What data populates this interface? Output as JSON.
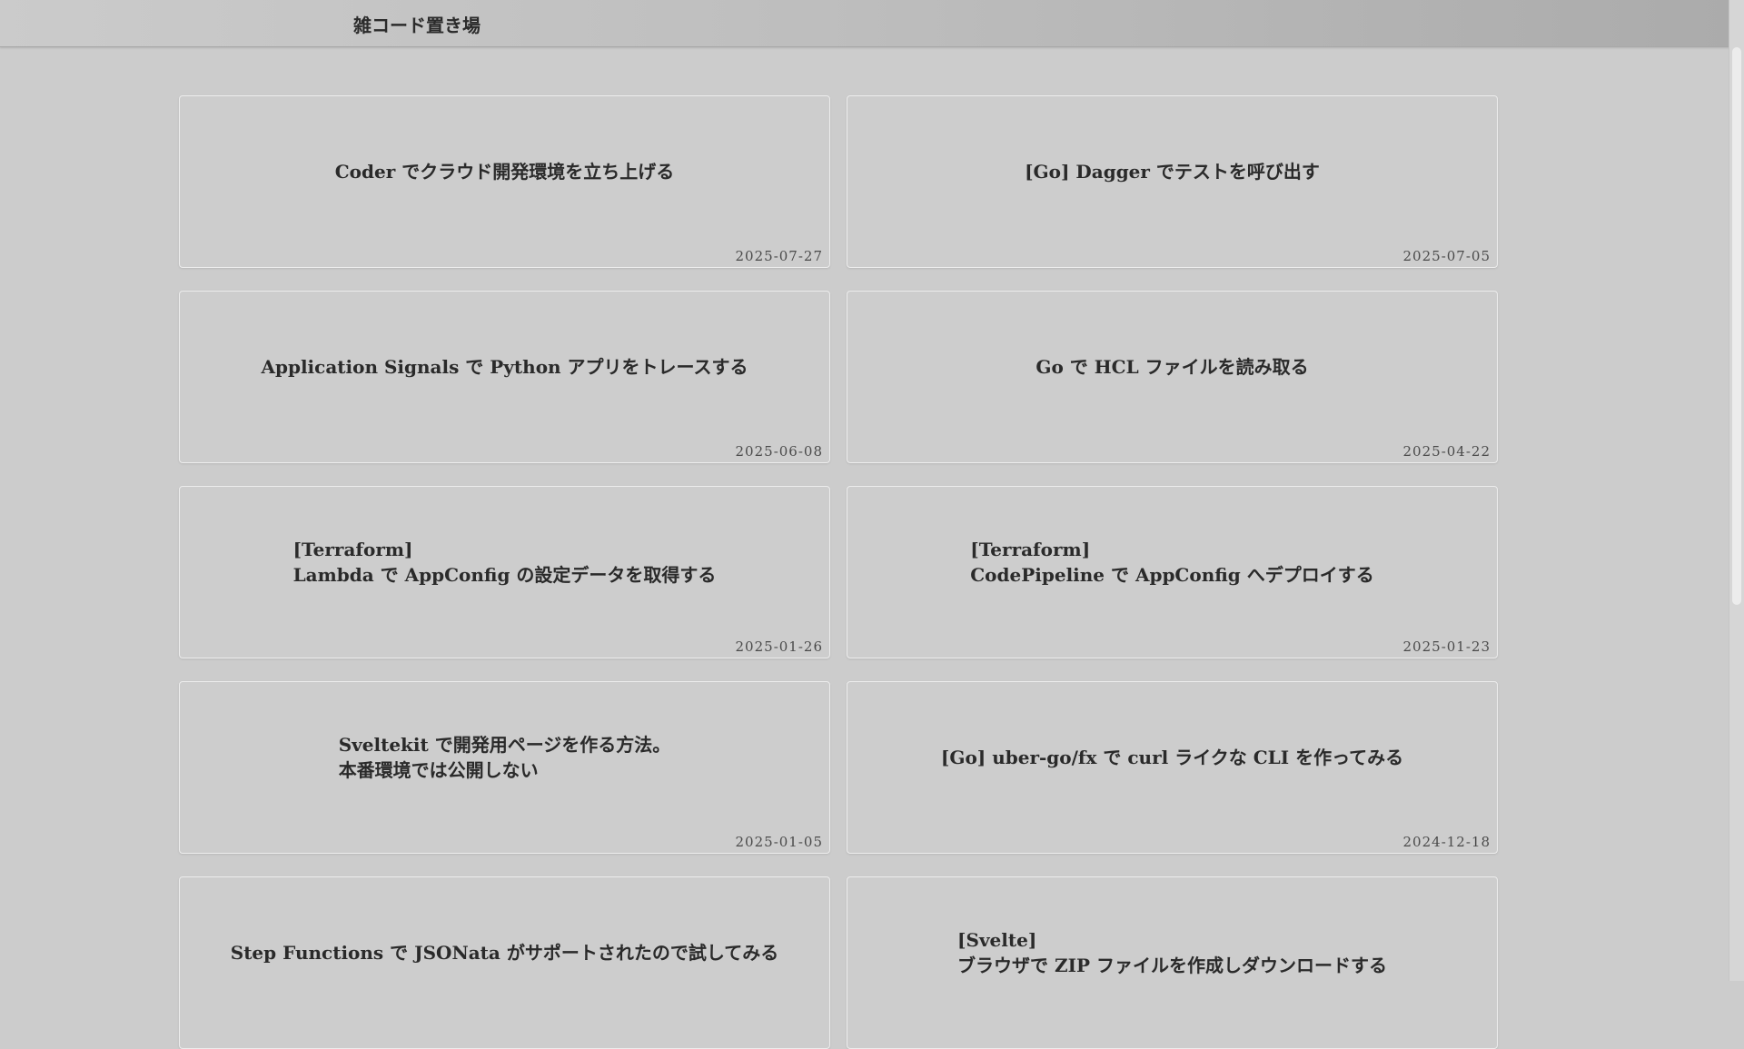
{
  "header": {
    "site_title": "雑コード置き場"
  },
  "posts": [
    {
      "title": "Coder でクラウド開発環境を立ち上げる",
      "date": "2025-07-27"
    },
    {
      "title": "[Go] Dagger でテストを呼び出す",
      "date": "2025-07-05"
    },
    {
      "title": "Application Signals で Python アプリをトレースする",
      "date": "2025-06-08"
    },
    {
      "title": "Go で HCL ファイルを読み取る",
      "date": "2025-04-22"
    },
    {
      "title": "[Terraform]\nLambda で AppConfig の設定データを取得する",
      "date": "2025-01-26"
    },
    {
      "title": "[Terraform]\nCodePipeline で AppConfig へデプロイする",
      "date": "2025-01-23"
    },
    {
      "title": "Sveltekit で開発用ページを作る方法。\n本番環境では公開しない",
      "date": "2025-01-05"
    },
    {
      "title": "[Go] uber-go/fx で curl ライクな CLI を作ってみる",
      "date": "2024-12-18"
    },
    {
      "title": "Step Functions で JSONata がサポートされたので試してみる",
      "date": ""
    },
    {
      "title": "[Svelte]\nブラウザで ZIP ファイルを作成しダウンロードする",
      "date": ""
    }
  ]
}
